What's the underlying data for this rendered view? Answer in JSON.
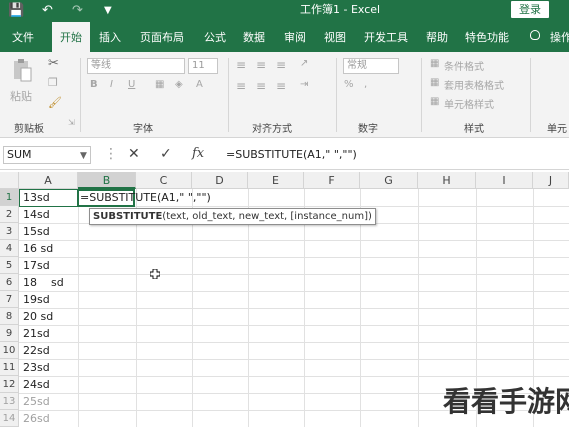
{
  "titlebar": {
    "title": "工作簿1 - Excel",
    "login_label": "登录"
  },
  "menu": {
    "items": [
      "文件",
      "开始",
      "插入",
      "页面布局",
      "公式",
      "数据",
      "审阅",
      "视图",
      "开发工具",
      "帮助",
      "特色功能",
      "操作"
    ],
    "active": "开始"
  },
  "ribbon": {
    "groups": [
      "剪贴板",
      "字体",
      "对齐方式",
      "数字",
      "样式",
      "单元"
    ],
    "paste_label": "粘贴",
    "font_name": "等线",
    "font_size": "11",
    "number_format": "常规",
    "style_items": [
      "条件格式",
      "套用表格格式",
      "单元格样式"
    ]
  },
  "formula_bar": {
    "name_box": "SUM",
    "fx_label": "fx",
    "formula": "=SUBSTITUTE(A1,\" \",\"\")"
  },
  "sheet": {
    "columns": [
      "A",
      "B",
      "C",
      "D",
      "E",
      "F",
      "G",
      "H",
      "I",
      "J"
    ],
    "selected_column": "B",
    "rows": [
      {
        "num": "1",
        "a": "13sd"
      },
      {
        "num": "2",
        "a": "14sd"
      },
      {
        "num": "3",
        "a": "15sd"
      },
      {
        "num": "4",
        "a": "16 sd"
      },
      {
        "num": "5",
        "a": "17sd"
      },
      {
        "num": "6",
        "a": "18    sd"
      },
      {
        "num": "7",
        "a": "19sd"
      },
      {
        "num": "8",
        "a": "20 sd"
      },
      {
        "num": "9",
        "a": "21sd"
      },
      {
        "num": "10",
        "a": "22sd"
      },
      {
        "num": "11",
        "a": "23sd"
      },
      {
        "num": "12",
        "a": "24sd"
      },
      {
        "num": "13",
        "a": "25sd"
      },
      {
        "num": "14",
        "a": "26sd"
      }
    ],
    "editing_cell_text": "=SUBSTITUTE(A1,\" \",\"\")",
    "tooltip": {
      "func": "SUBSTITUTE",
      "args": "(text, old_text, new_text, [instance_num])"
    }
  },
  "watermark": "看看手游网",
  "colors": {
    "excel_green": "#217346",
    "ribbon_bg": "#f3f3f3"
  }
}
